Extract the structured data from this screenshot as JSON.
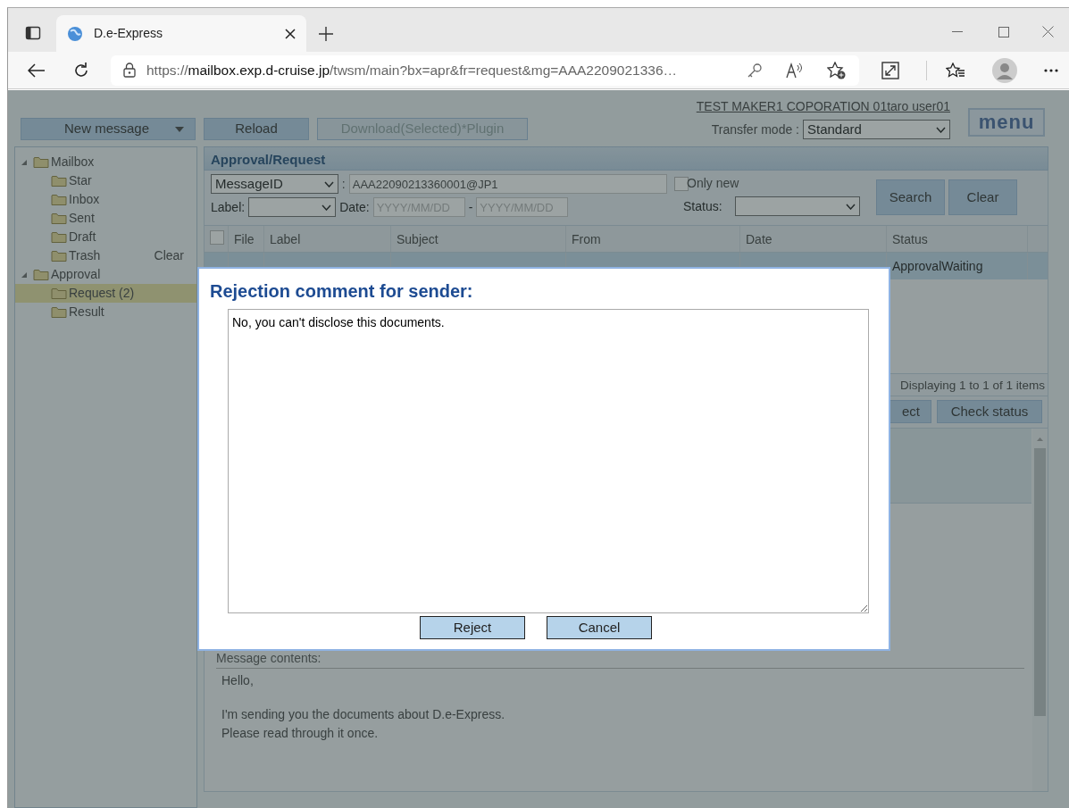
{
  "browser": {
    "tab_title": "D.e-Express",
    "url_scheme": "https://",
    "url_host": "mailbox.exp.d-cruise.jp",
    "url_path": "/twsm/main?bx=apr&fr=request&mg=AAA2209021336…"
  },
  "header": {
    "new_message": "New message",
    "toolbar": [
      {
        "label": "Reload",
        "disabled": false
      },
      {
        "label": "Download(Selected)*Plugin",
        "disabled": true
      }
    ],
    "user": "TEST MAKER1 COPORATION 01taro user01",
    "transfer_mode_label": "Transfer mode :",
    "transfer_mode": "Standard",
    "menu": "menu"
  },
  "sidebar": {
    "items": [
      {
        "label": "Mailbox",
        "expanded": true,
        "selected": false,
        "children": [
          {
            "label": "Star",
            "selected": false
          },
          {
            "label": "Inbox",
            "selected": false
          },
          {
            "label": "Sent",
            "selected": false
          },
          {
            "label": "Draft",
            "selected": false
          },
          {
            "label": "Trash",
            "selected": false,
            "action": "Clear"
          }
        ]
      },
      {
        "label": "Approval",
        "expanded": true,
        "selected": false,
        "children": [
          {
            "label": "Request (2)",
            "selected": true
          },
          {
            "label": "Result",
            "selected": false
          }
        ]
      }
    ]
  },
  "panel": {
    "title": "Approval/Request",
    "filter": {
      "field": "MessageID",
      "value_sep": ":",
      "value": "AAA22090213360001@JP1",
      "only_new": {
        "label": "Only new",
        "checked": false
      },
      "label_label": "Label:",
      "date_label": "Date:",
      "date_from_placeholder": "YYYY/MM/DD",
      "date_sep": "-",
      "date_to_placeholder": "YYYY/MM/DD",
      "status_label": "Status:",
      "buttons": [
        "Search",
        "Clear"
      ]
    },
    "table": {
      "select_all_checked": false,
      "columns": [
        "File",
        "Label",
        "Subject",
        "From",
        "Date",
        "Status"
      ],
      "rows": [
        {
          "status": "ApprovalWaiting",
          "selected": true
        }
      ]
    },
    "pager": "Displaying 1 to 1 of 1 items",
    "actions": [
      "ect",
      "Check status"
    ],
    "detail": {
      "contents_label": "Message contents:",
      "paragraphs": [
        [
          "Hello,"
        ],
        [
          "I'm sending you the documents about D.e-Express.",
          "Please read through it once."
        ]
      ]
    }
  },
  "modal": {
    "title": "Rejection comment for sender:",
    "comment": "No, you can't disclose this documents.",
    "buttons": [
      "Reject",
      "Cancel"
    ]
  }
}
